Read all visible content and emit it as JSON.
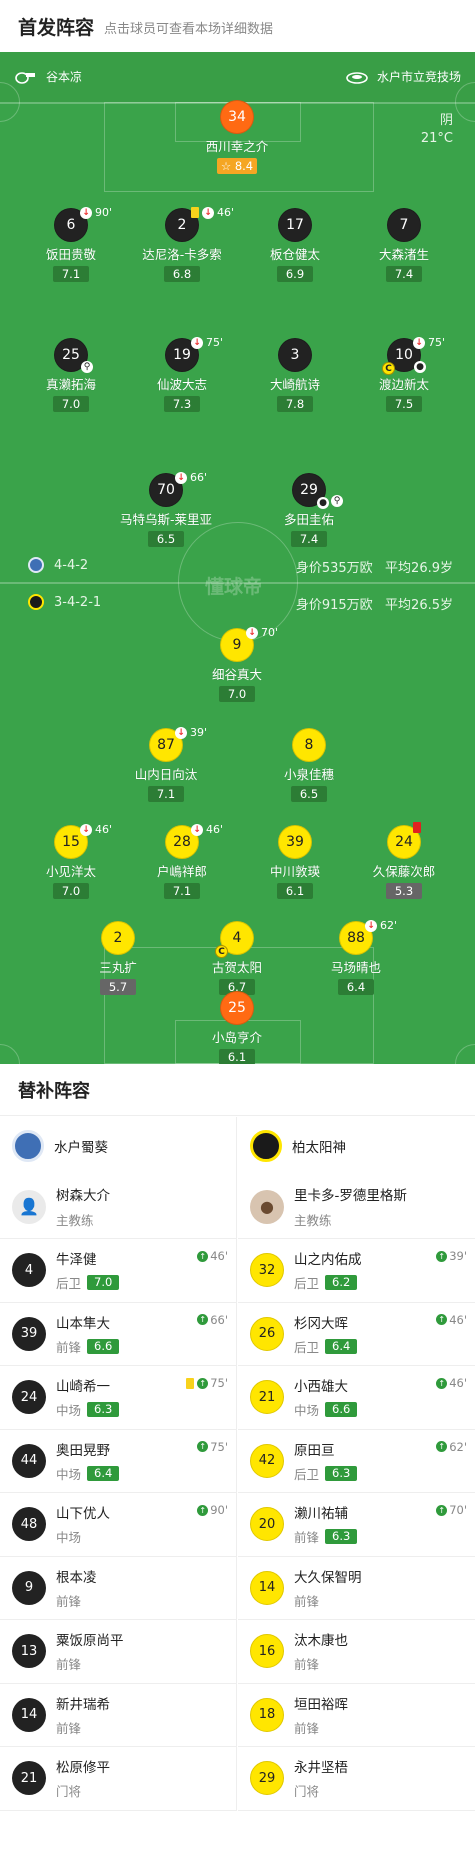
{
  "header": {
    "title": "首发阵容",
    "subtitle": "点击球员可查看本场详细数据"
  },
  "match": {
    "coach_label": "谷本凉",
    "venue": "水户市立竞技场",
    "weather": "阴",
    "temperature": "21°C"
  },
  "home_info": {
    "formation": "4-4-2",
    "value": "身价535万欧",
    "age": "平均26.9岁"
  },
  "away_info": {
    "formation": "3-4-2-1",
    "value": "身价915万欧",
    "age": "平均26.5岁"
  },
  "watermark": "懂球帝",
  "home_players": [
    {
      "num": "34",
      "name": "西川幸之介",
      "rating": "8.4",
      "kit": "o"
    },
    {
      "num": "6",
      "name": "饭田贵敬",
      "rating": "7.1",
      "kit": "d",
      "sub_out": "90'"
    },
    {
      "num": "2",
      "name": "达尼洛-卡多索",
      "rating": "6.8",
      "kit": "d",
      "sub_out": "46'"
    },
    {
      "num": "17",
      "name": "板仓健太",
      "rating": "6.9",
      "kit": "d"
    },
    {
      "num": "7",
      "name": "大森渚生",
      "rating": "7.4",
      "kit": "d"
    },
    {
      "num": "25",
      "name": "真濑拓海",
      "rating": "7.0",
      "kit": "d"
    },
    {
      "num": "19",
      "name": "仙波大志",
      "rating": "7.3",
      "kit": "d",
      "sub_out": "75'"
    },
    {
      "num": "3",
      "name": "大崎航诗",
      "rating": "7.8",
      "kit": "d"
    },
    {
      "num": "10",
      "name": "渡边新太",
      "rating": "7.5",
      "kit": "d",
      "sub_out": "75'"
    },
    {
      "num": "70",
      "name": "马特乌斯-莱里亚",
      "rating": "6.5",
      "kit": "d",
      "sub_out": "66'"
    },
    {
      "num": "29",
      "name": "多田圭佑",
      "rating": "7.4",
      "kit": "d"
    }
  ],
  "away_players": [
    {
      "num": "9",
      "name": "细谷真大",
      "rating": "7.0",
      "kit": "y",
      "sub_out": "70'"
    },
    {
      "num": "87",
      "name": "山内日向汰",
      "rating": "7.1",
      "kit": "y",
      "sub_out": "39'"
    },
    {
      "num": "8",
      "name": "小泉佳穗",
      "rating": "6.5",
      "kit": "y"
    },
    {
      "num": "15",
      "name": "小见洋太",
      "rating": "7.0",
      "kit": "y",
      "sub_out": "46'"
    },
    {
      "num": "28",
      "name": "户嶋祥郎",
      "rating": "7.1",
      "kit": "y",
      "sub_out": "46'"
    },
    {
      "num": "39",
      "name": "中川敦瑛",
      "rating": "6.1",
      "kit": "y"
    },
    {
      "num": "24",
      "name": "久保藤次郎",
      "rating": "5.3",
      "kit": "y"
    },
    {
      "num": "2",
      "name": "三丸扩",
      "rating": "5.7",
      "kit": "y"
    },
    {
      "num": "4",
      "name": "古贺太阳",
      "rating": "6.7",
      "kit": "y"
    },
    {
      "num": "88",
      "name": "马场晴也",
      "rating": "6.4",
      "kit": "y",
      "sub_out": "62'"
    },
    {
      "num": "25",
      "name": "小岛亨介",
      "rating": "6.1",
      "kit": "o"
    }
  ],
  "subs": {
    "title": "替补阵容",
    "home": {
      "team": "水户蜀葵",
      "coach": "树森大介",
      "coach_role": "主教练",
      "colors": {
        "logo": "#3f6fb5"
      },
      "players": [
        {
          "num": "4",
          "name": "牛泽健",
          "pos": "后卫",
          "rating": "7.0",
          "time": "46'"
        },
        {
          "num": "39",
          "name": "山本隼大",
          "pos": "前锋",
          "rating": "6.6",
          "time": "66'"
        },
        {
          "num": "24",
          "name": "山崎希一",
          "pos": "中场",
          "rating": "6.3",
          "time": "75'",
          "yellow": true
        },
        {
          "num": "44",
          "name": "奥田晃野",
          "pos": "中场",
          "rating": "6.4",
          "time": "75'"
        },
        {
          "num": "48",
          "name": "山下优人",
          "pos": "中场",
          "rating": "",
          "time": "90'"
        },
        {
          "num": "9",
          "name": "根本凌",
          "pos": "前锋",
          "rating": "",
          "time": ""
        },
        {
          "num": "13",
          "name": "粟饭原尚平",
          "pos": "前锋",
          "rating": "",
          "time": ""
        },
        {
          "num": "14",
          "name": "新井瑞希",
          "pos": "前锋",
          "rating": "",
          "time": ""
        },
        {
          "num": "21",
          "name": "松原修平",
          "pos": "门将",
          "rating": "",
          "time": ""
        }
      ]
    },
    "away": {
      "team": "柏太阳神",
      "coach": "里卡多-罗德里格斯",
      "coach_role": "主教练",
      "colors": {
        "logo": "#1a1a1a"
      },
      "players": [
        {
          "num": "32",
          "name": "山之内佑成",
          "pos": "后卫",
          "rating": "6.2",
          "time": "39'"
        },
        {
          "num": "26",
          "name": "杉冈大晖",
          "pos": "后卫",
          "rating": "6.4",
          "time": "46'"
        },
        {
          "num": "21",
          "name": "小西雄大",
          "pos": "中场",
          "rating": "6.6",
          "time": "46'"
        },
        {
          "num": "42",
          "name": "原田亘",
          "pos": "后卫",
          "rating": "6.3",
          "time": "62'"
        },
        {
          "num": "20",
          "name": "濑川祐辅",
          "pos": "前锋",
          "rating": "6.3",
          "time": "70'"
        },
        {
          "num": "14",
          "name": "大久保智明",
          "pos": "前锋",
          "rating": "",
          "time": ""
        },
        {
          "num": "16",
          "name": "汰木康也",
          "pos": "前锋",
          "rating": "",
          "time": ""
        },
        {
          "num": "18",
          "name": "垣田裕晖",
          "pos": "前锋",
          "rating": "",
          "time": ""
        },
        {
          "num": "29",
          "name": "永井坚梧",
          "pos": "门将",
          "rating": "",
          "time": ""
        }
      ]
    }
  }
}
